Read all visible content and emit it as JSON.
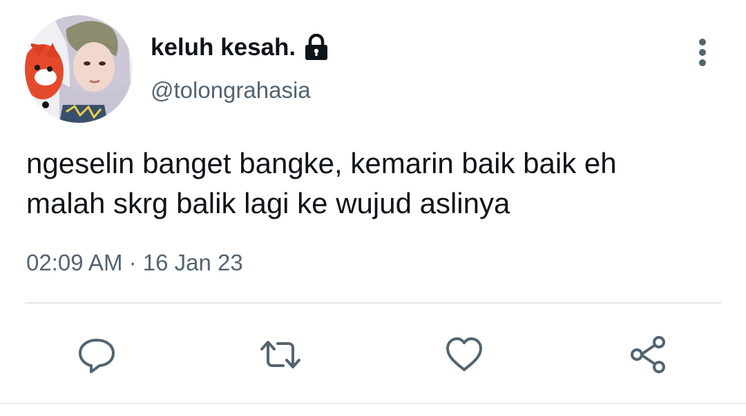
{
  "user": {
    "display_name": "keluh kesah.",
    "handle": "@tolongrahasia",
    "avatar_icon": "profile-photo",
    "protected_icon": "lock-icon"
  },
  "tweet": {
    "text_lines": [
      "ngeselin banget bangke, kemarin baik baik eh",
      "malah skrg balik lagi ke wujud aslinya"
    ],
    "timestamp": "02:09 AM · 16 Jan 23"
  },
  "actions": [
    {
      "name": "reply",
      "icon": "comment-icon"
    },
    {
      "name": "retweet",
      "icon": "retweet-icon"
    },
    {
      "name": "like",
      "icon": "heart-icon"
    },
    {
      "name": "share",
      "icon": "share-icon"
    }
  ],
  "colors": {
    "text": "#0f1419",
    "secondary": "#536471",
    "icon": "#536471",
    "divider": "#e1e6ea"
  }
}
